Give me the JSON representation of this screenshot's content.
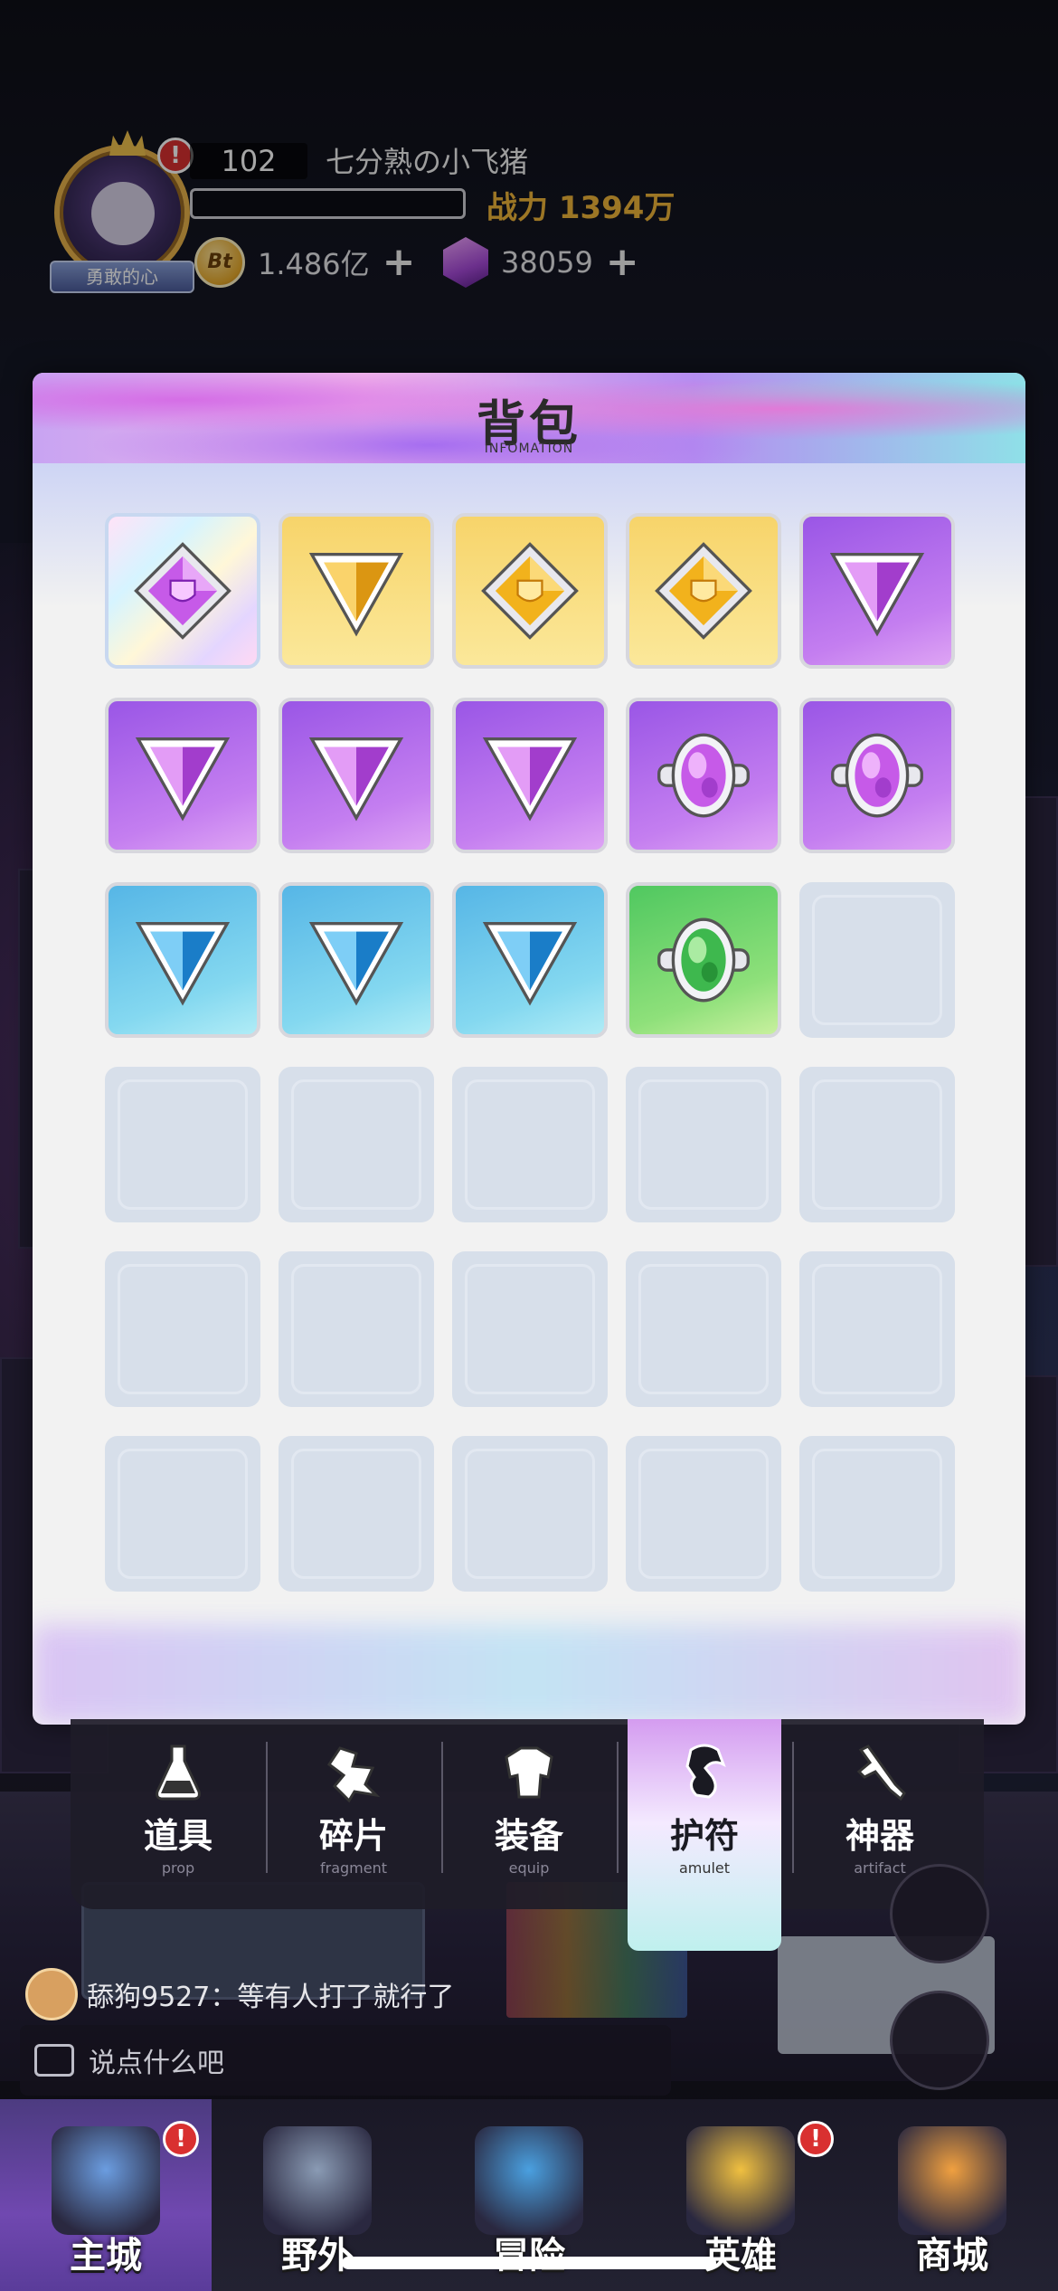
{
  "player": {
    "level": "102",
    "name": "七分熟の小飞猪",
    "title_badge": "勇敢的心",
    "exp_fraction": 0.0,
    "power_label": "战力 1394万",
    "alert": "!",
    "coins": {
      "icon": "bt-coin-icon",
      "icon_text": "Bt",
      "value": "1.486亿",
      "plus": "+"
    },
    "gems": {
      "icon": "purple-gem-icon",
      "value": "38059",
      "plus": "+"
    }
  },
  "bag": {
    "title": "背包",
    "subtitle": "INFOMATION",
    "slots": [
      {
        "kind": "rainbow",
        "item": "shield-gem-purple-icon"
      },
      {
        "kind": "gold",
        "item": "triangle-gem-gold-icon"
      },
      {
        "kind": "gold",
        "item": "shield-gem-gold-icon"
      },
      {
        "kind": "gold",
        "item": "shield-gem-gold-icon"
      },
      {
        "kind": "purple",
        "item": "triangle-gem-purple-icon"
      },
      {
        "kind": "purple",
        "item": "triangle-gem-purple-icon"
      },
      {
        "kind": "purple",
        "item": "triangle-gem-purple-icon"
      },
      {
        "kind": "purple",
        "item": "triangle-gem-purple-icon"
      },
      {
        "kind": "purple",
        "item": "ring-gem-purple-icon"
      },
      {
        "kind": "purple",
        "item": "ring-gem-purple-icon"
      },
      {
        "kind": "blue",
        "item": "triangle-gem-blue-icon"
      },
      {
        "kind": "blue",
        "item": "triangle-gem-blue-icon"
      },
      {
        "kind": "blue",
        "item": "triangle-gem-blue-icon"
      },
      {
        "kind": "green",
        "item": "ring-gem-green-icon"
      },
      {
        "kind": "empty"
      },
      {
        "kind": "empty"
      },
      {
        "kind": "empty"
      },
      {
        "kind": "empty"
      },
      {
        "kind": "empty"
      },
      {
        "kind": "empty"
      },
      {
        "kind": "empty"
      },
      {
        "kind": "empty"
      },
      {
        "kind": "empty"
      },
      {
        "kind": "empty"
      },
      {
        "kind": "empty"
      },
      {
        "kind": "empty"
      },
      {
        "kind": "empty"
      },
      {
        "kind": "empty"
      },
      {
        "kind": "empty"
      },
      {
        "kind": "empty"
      }
    ]
  },
  "tabs": [
    {
      "label": "道具",
      "sub": "prop",
      "icon": "potion-icon",
      "active": false
    },
    {
      "label": "碎片",
      "sub": "fragment",
      "icon": "fragment-icon",
      "active": false
    },
    {
      "label": "装备",
      "sub": "equip",
      "icon": "armor-icon",
      "active": false
    },
    {
      "label": "护符",
      "sub": "amulet",
      "icon": "amulet-icon",
      "active": true
    },
    {
      "label": "神器",
      "sub": "artifact",
      "icon": "sword-icon",
      "active": false
    }
  ],
  "chat": {
    "last_message": "舔狗9527：等有人打了就行了",
    "input_placeholder": "说点什么吧"
  },
  "nav": [
    {
      "label": "主城",
      "icon": "city-icon",
      "active": true,
      "alert": "!"
    },
    {
      "label": "野外",
      "icon": "field-castle-icon",
      "active": false
    },
    {
      "label": "冒险",
      "icon": "adventure-creature-icon",
      "active": false
    },
    {
      "label": "英雄",
      "icon": "hero-icon",
      "active": false,
      "alert": "!"
    },
    {
      "label": "商城",
      "icon": "shop-icon",
      "active": false
    }
  ],
  "colors": {
    "power": "#f0b53a",
    "alert_red": "#d93030",
    "active_nav": "#7048b0"
  }
}
